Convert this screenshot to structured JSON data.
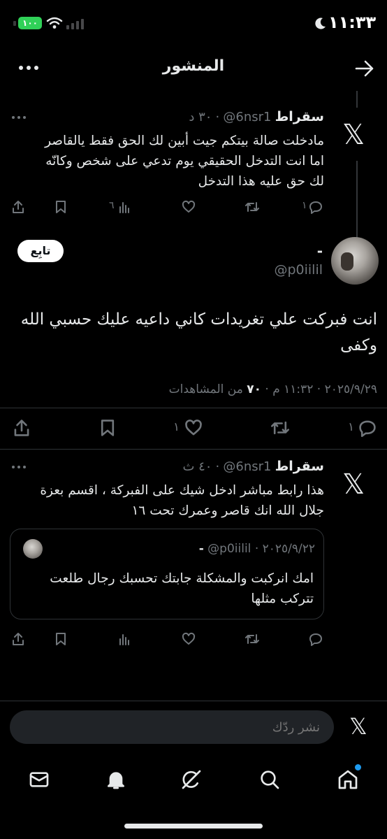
{
  "status_bar": {
    "time": "١١:٣٣",
    "battery": "١٠٠"
  },
  "header": {
    "title": "المنشور",
    "back_icon": "arrow-right-icon",
    "more_icon": "more-dots-icon"
  },
  "parent_tweet": {
    "name": "سقراط",
    "handle": "@6nsr1",
    "time": "٣٠ د",
    "text": "مادخلت صالة بيتكم جيت أبين لك الحق فقط يالقاصر اما انت التدخل الحقيقي يوم تدعي على شخص وكانّه لك حق عليه هذا التدخل",
    "views": "٦",
    "replies": "١"
  },
  "main_tweet": {
    "name": "-",
    "handle": "@p0iilil",
    "follow_label": "تابِع",
    "text": "انت فبركت علي تغريدات كاني داعيه عليك حسبي الله وكفى",
    "meta": "٢٠٢٥/٩/٢٩ · ١١:٣٢ م ·",
    "views_count": "٧٠",
    "views_label": "من المشاهدات",
    "likes": "١",
    "replies": "١"
  },
  "reply_tweet": {
    "name": "سقراط",
    "handle": "@6nsr1",
    "time": "٤٠ ث",
    "text": "هذا رابط مباشر ادخل شيك على الفبركة ، اقسم بعزة جلال الله انك قاصر وعمرك تحت ١٦",
    "quote": {
      "name": "-",
      "handle": "@p0iilil",
      "date": "٢٠٢٥/٩/٢٢",
      "text": "امك انركبت والمشكلة جابتك تحسبك رجال طلعت تتركب مثلها"
    }
  },
  "composer": {
    "placeholder": "نشر ردّك"
  },
  "bottom_nav": {
    "items": [
      "mail-icon",
      "bell-icon",
      "grok-icon",
      "search-icon",
      "home-icon"
    ]
  },
  "colors": {
    "background": "#000000",
    "text": "#e7e9ea",
    "muted": "#71767b",
    "accent": "#1d9bf0",
    "battery": "#30d158"
  }
}
